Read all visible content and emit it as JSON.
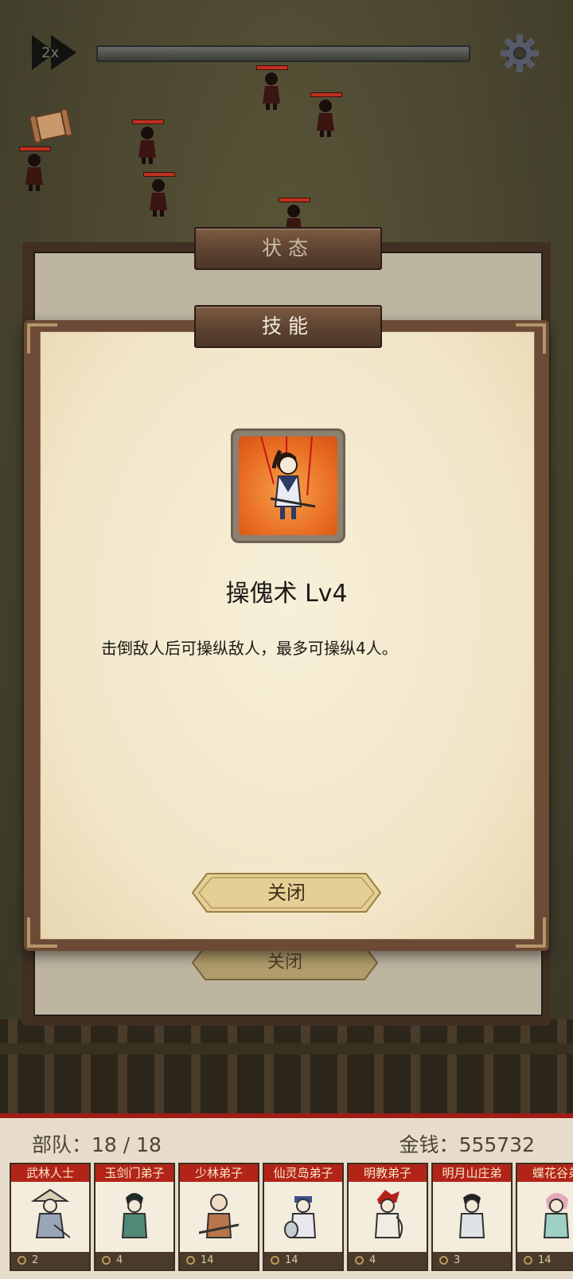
{
  "top_bar": {
    "speed_label": "2x"
  },
  "status_panel": {
    "title": "状态",
    "close_label": "关闭"
  },
  "skill_dialog": {
    "title": "技能",
    "skill_name": "操傀术 Lv4",
    "description": "击倒敌人后可操纵敌人，最多可操纵4人。",
    "close_label": "关闭",
    "icon": "puppet-skill-icon"
  },
  "bottom_bar": {
    "troops_label": "部队：",
    "troops_value": "18 / 18",
    "money_label": "金钱：",
    "money_value": "555732",
    "units": [
      {
        "name": "武林人士",
        "cost": "2"
      },
      {
        "name": "玉剑门弟子",
        "cost": "4"
      },
      {
        "name": "少林弟子",
        "cost": "14"
      },
      {
        "name": "仙灵岛弟子",
        "cost": "14"
      },
      {
        "name": "明教弟子",
        "cost": "4"
      },
      {
        "name": "明月山庄弟",
        "cost": "3"
      },
      {
        "name": "蝶花谷弟",
        "cost": "14"
      }
    ]
  },
  "colors": {
    "accent_red": "#b32418",
    "paper": "#f1e5c6",
    "wood": "#5b4130"
  }
}
